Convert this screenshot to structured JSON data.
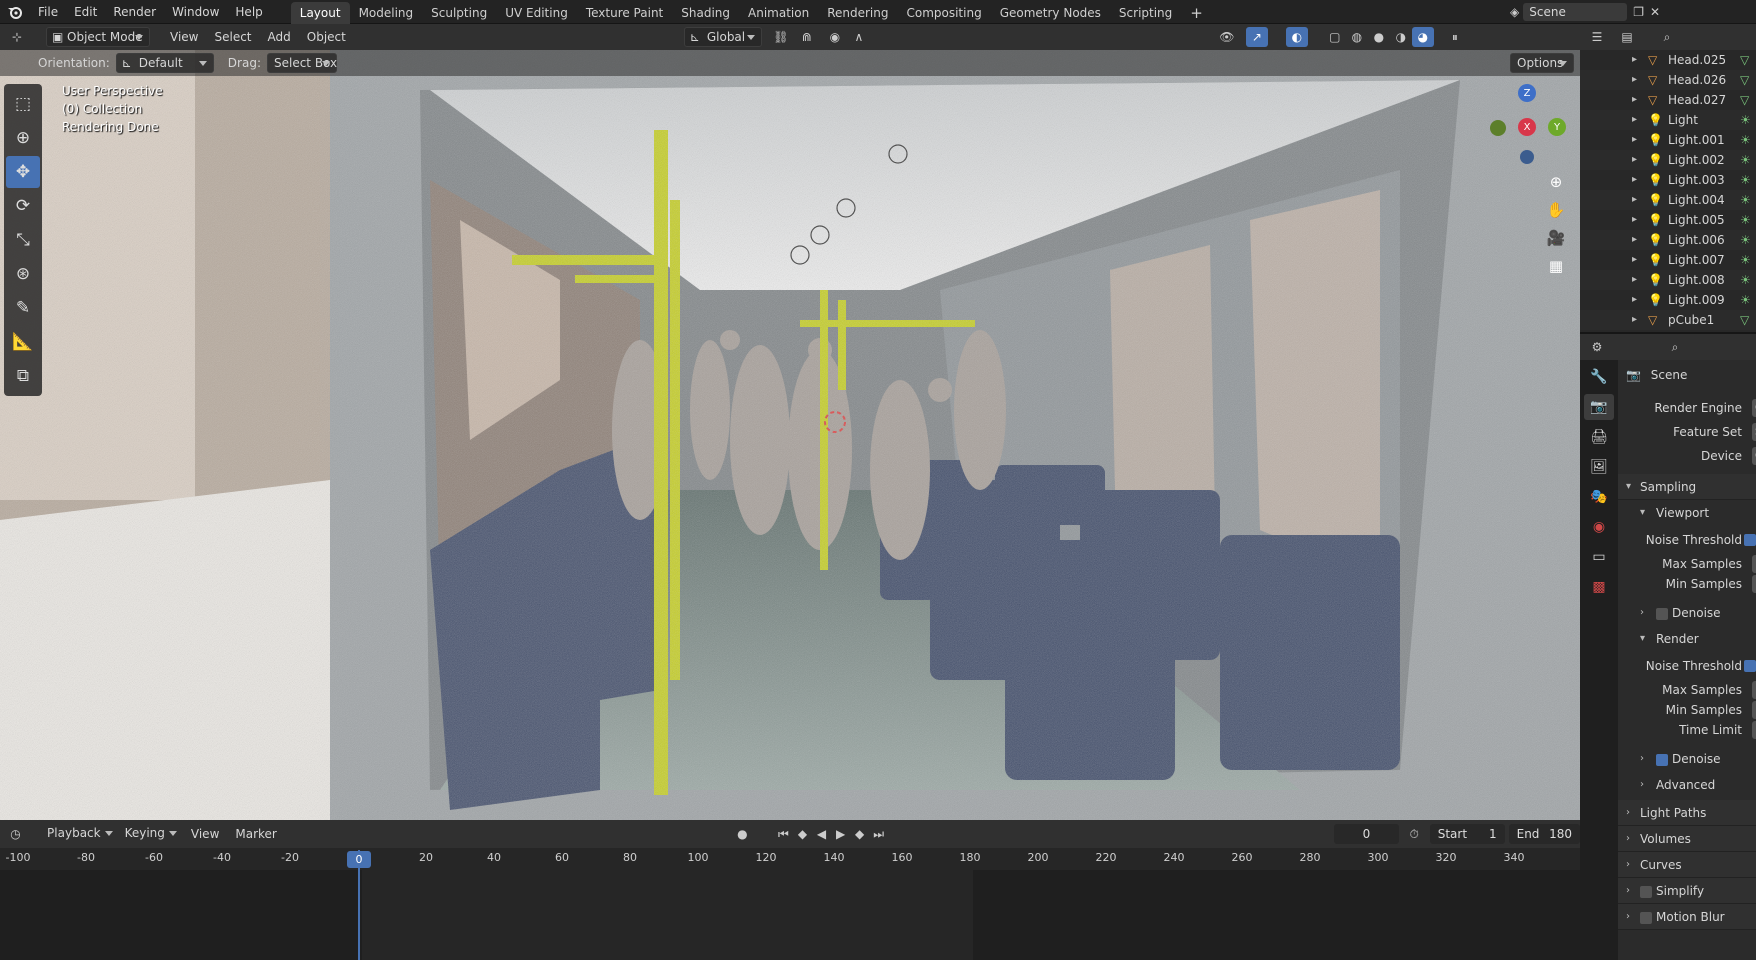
{
  "topbar": {
    "menus": [
      "File",
      "Edit",
      "Render",
      "Window",
      "Help"
    ],
    "workspaces": [
      "Layout",
      "Modeling",
      "Sculpting",
      "UV Editing",
      "Texture Paint",
      "Shading",
      "Animation",
      "Rendering",
      "Compositing",
      "Geometry Nodes",
      "Scripting"
    ],
    "active_workspace": "Layout",
    "add_tab": "+",
    "scene_name": "Scene"
  },
  "viewport_header": {
    "mode": "Object Mode",
    "menus": [
      "View",
      "Select",
      "Add",
      "Object"
    ],
    "transform_orientation": "Global"
  },
  "viewport_sub": {
    "orientation_label": "Orientation:",
    "orientation_value": "Default",
    "drag_label": "Drag:",
    "drag_value": "Select Box",
    "options": "Options"
  },
  "overlay": {
    "line1": "User Perspective",
    "line2": "(0) Collection",
    "line3": "Rendering Done"
  },
  "gizmo": {
    "z": "Z",
    "x": "X",
    "y": "Y"
  },
  "timeline": {
    "menus": [
      "Playback",
      "Keying",
      "View",
      "Marker"
    ],
    "current_frame": "0",
    "start_label": "Start",
    "start_value": "1",
    "end_label": "End",
    "end_value": "180",
    "ticks": [
      "-100",
      "-80",
      "-60",
      "-40",
      "-20",
      "0",
      "20",
      "40",
      "60",
      "80",
      "100",
      "120",
      "140",
      "160",
      "180",
      "200",
      "220",
      "240",
      "260",
      "280",
      "300",
      "320",
      "340"
    ]
  },
  "outliner": {
    "items": [
      {
        "name": "Head.025",
        "type": "mesh"
      },
      {
        "name": "Head.026",
        "type": "mesh"
      },
      {
        "name": "Head.027",
        "type": "mesh"
      },
      {
        "name": "Light",
        "type": "light"
      },
      {
        "name": "Light.001",
        "type": "light"
      },
      {
        "name": "Light.002",
        "type": "light"
      },
      {
        "name": "Light.003",
        "type": "light"
      },
      {
        "name": "Light.004",
        "type": "light"
      },
      {
        "name": "Light.005",
        "type": "light"
      },
      {
        "name": "Light.006",
        "type": "light"
      },
      {
        "name": "Light.007",
        "type": "light"
      },
      {
        "name": "Light.008",
        "type": "light"
      },
      {
        "name": "Light.009",
        "type": "light"
      },
      {
        "name": "pCube1",
        "type": "mesh"
      }
    ]
  },
  "properties": {
    "scene_label": "Scene",
    "render_engine_label": "Render Engine",
    "render_engine_value": "C",
    "feature_set_label": "Feature Set",
    "feature_set_value": "S",
    "device_label": "Device",
    "device_value": "G",
    "sampling": "Sampling",
    "viewport": "Viewport",
    "noise_threshold": "Noise Threshold",
    "max_samples": "Max Samples",
    "min_samples": "Min Samples",
    "denoise": "Denoise",
    "render": "Render",
    "render_noise_threshold": "Noise Threshold",
    "render_max_samples": "Max Samples",
    "render_min_samples": "Min Samples",
    "time_limit": "Time Limit",
    "render_denoise": "Denoise",
    "advanced": "Advanced",
    "light_paths": "Light Paths",
    "volumes": "Volumes",
    "curves": "Curves",
    "simplify": "Simplify",
    "motion_blur": "Motion Blur"
  },
  "colors": {
    "accent_blue": "#4772b3",
    "mesh_orange": "#e09a4a",
    "light_green": "#79c27b",
    "rail_yellow": "#c8d21e",
    "seat_blue": "#3e4a68"
  }
}
